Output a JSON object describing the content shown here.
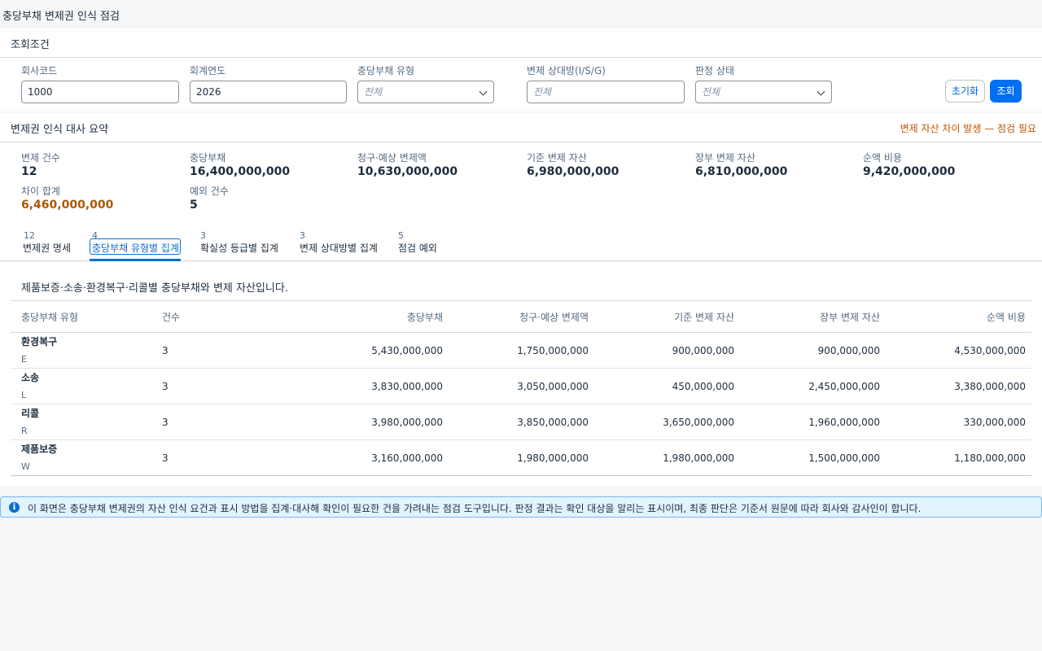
{
  "page_title": "충당부채 변제권 인식 점검",
  "filter": {
    "header": "조회조건",
    "company_code": {
      "label": "회사코드",
      "value": "1000"
    },
    "fiscal_year": {
      "label": "회계연도",
      "value": "2026"
    },
    "provision_type": {
      "label": "충당부채 유형",
      "value": "전체"
    },
    "counterparty": {
      "label": "변제 상대방(I/S/G)",
      "placeholder": "전체"
    },
    "judgement_status": {
      "label": "판정 상태",
      "value": "전체"
    },
    "reset_label": "초기화",
    "search_label": "조회"
  },
  "summary": {
    "header": "변제권 인식 대사 요약",
    "warning": "변제 자산 차이 발생 — 점검 필요",
    "kpis": [
      {
        "label": "변제 건수",
        "value": "12"
      },
      {
        "label": "충당부채",
        "value": "16,400,000,000"
      },
      {
        "label": "청구·예상 변제액",
        "value": "10,630,000,000"
      },
      {
        "label": "기준 변제 자산",
        "value": "6,980,000,000"
      },
      {
        "label": "장부 변제 자산",
        "value": "6,810,000,000"
      },
      {
        "label": "순액 비용",
        "value": "9,420,000,000"
      },
      {
        "label": "차이 합계",
        "value": "6,460,000,000"
      },
      {
        "label": "예외 건수",
        "value": "5"
      }
    ]
  },
  "tabs": [
    {
      "count": "12",
      "label": "변제권 명세"
    },
    {
      "count": "4",
      "label": "충당부채 유형별 집계"
    },
    {
      "count": "3",
      "label": "확실성 등급별 집계"
    },
    {
      "count": "3",
      "label": "변제 상대방별 집계"
    },
    {
      "count": "5",
      "label": "점검 예외"
    }
  ],
  "content": {
    "description": "제품보증·소송·환경복구·리콜별 충당부채와 변제 자산입니다.",
    "columns": [
      "충당부채 유형",
      "건수",
      "충당부채",
      "청구·예상 변제액",
      "기준 변제 자산",
      "장부 변제 자산",
      "순액 비용"
    ],
    "rows": [
      {
        "name": "환경복구",
        "code": "E",
        "count": "3",
        "provision": "5,430,000,000",
        "claimed": "1,750,000,000",
        "base_asset": "900,000,000",
        "book_asset": "900,000,000",
        "net_expense": "4,530,000,000"
      },
      {
        "name": "소송",
        "code": "L",
        "count": "3",
        "provision": "3,830,000,000",
        "claimed": "3,050,000,000",
        "base_asset": "450,000,000",
        "book_asset": "2,450,000,000",
        "net_expense": "3,380,000,000"
      },
      {
        "name": "리콜",
        "code": "R",
        "count": "3",
        "provision": "3,980,000,000",
        "claimed": "3,850,000,000",
        "base_asset": "3,650,000,000",
        "book_asset": "1,960,000,000",
        "net_expense": "330,000,000"
      },
      {
        "name": "제품보증",
        "code": "W",
        "count": "3",
        "provision": "3,160,000,000",
        "claimed": "1,980,000,000",
        "base_asset": "1,980,000,000",
        "book_asset": "1,500,000,000",
        "net_expense": "1,180,000,000"
      }
    ]
  },
  "info": {
    "icon": "info-icon",
    "text": "이 화면은 충당부채 변제권의 자산 인식 요건과 표시 방법을 집계·대사해 확인이 필요한 건을 가려내는 점검 도구입니다. 판정 결과는 확인 대상을 알리는 표시이며, 최종 판단은 기준서 원문에 따라 회사와 감사인이 합니다."
  }
}
